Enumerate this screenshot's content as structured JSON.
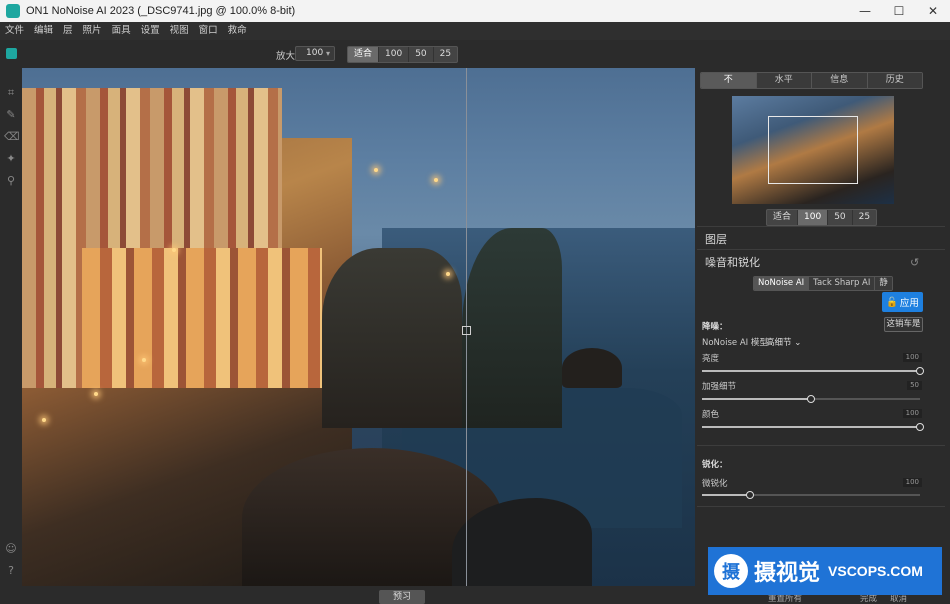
{
  "window": {
    "title": "ON1 NoNoise AI 2023 (_DSC9741.jpg @ 100.0% 8-bit)",
    "minimize": "—",
    "maximize": "☐",
    "close": "✕"
  },
  "menu": [
    "文件",
    "编辑",
    "层",
    "照片",
    "面具",
    "设置",
    "视图",
    "窗口",
    "救命"
  ],
  "toolbar": {
    "zoom_label": "放大",
    "zoom_value": "100",
    "zoom_presets": [
      "适合",
      "100",
      "50",
      "25"
    ],
    "zoom_active": "适合"
  },
  "left_tools": [
    "crop-icon",
    "brush-icon",
    "eraser-icon",
    "retouch-icon",
    "zoom-icon",
    "user-icon",
    "help-icon"
  ],
  "preview": {
    "button": "预习"
  },
  "panel": {
    "tabs": [
      "不",
      "水平",
      "信息",
      "历史"
    ],
    "nav_zoom_presets": [
      "适合",
      "100",
      "50",
      "25"
    ],
    "layers_title": "图层",
    "noise_title": "噪音和锐化",
    "engines": [
      "NoNoise AI",
      "Tack Sharp AI",
      "静"
    ],
    "apply": "应用",
    "undo": "这销车是",
    "denoise_label": "降噪：",
    "model_label": "NoNoise AI 模型",
    "model_value": "高细节",
    "sliders": [
      {
        "label": "亮度",
        "value": "100",
        "pct": 100
      },
      {
        "label": "加强细节",
        "value": "50",
        "pct": 50
      },
      {
        "label": "颜色",
        "value": "100",
        "pct": 100
      }
    ],
    "sharpen_label": "锐化：",
    "sharpen_slider": {
      "label": "微锐化",
      "value": "100",
      "pct": 22
    },
    "footer_left": "重置所有",
    "footer_right": [
      "完成",
      "取消"
    ]
  },
  "watermark": {
    "logo": "摄",
    "cn": "摄视觉",
    "en": "VSCOPS.COM"
  }
}
